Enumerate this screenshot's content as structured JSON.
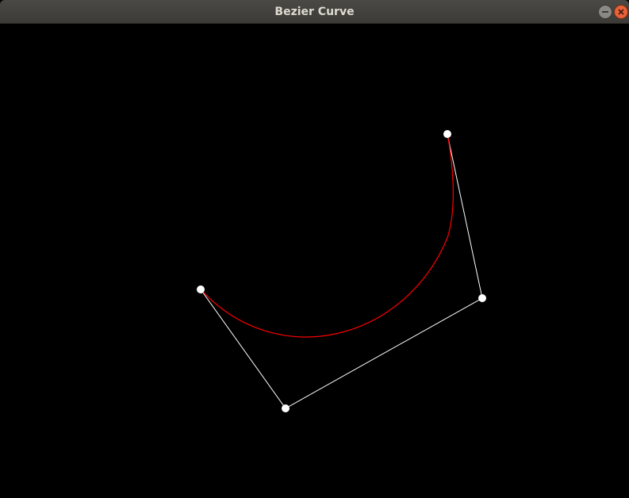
{
  "window": {
    "title": "Bezier Curve"
  },
  "colors": {
    "background": "#000000",
    "curve": "#ff0000",
    "control_polygon": "#ffffff",
    "control_point": "#ffffff",
    "close_button": "#e9623a",
    "minimize_button": "#8a8985"
  },
  "icons": {
    "minimize": "minimize-icon",
    "close": "close-icon"
  }
}
